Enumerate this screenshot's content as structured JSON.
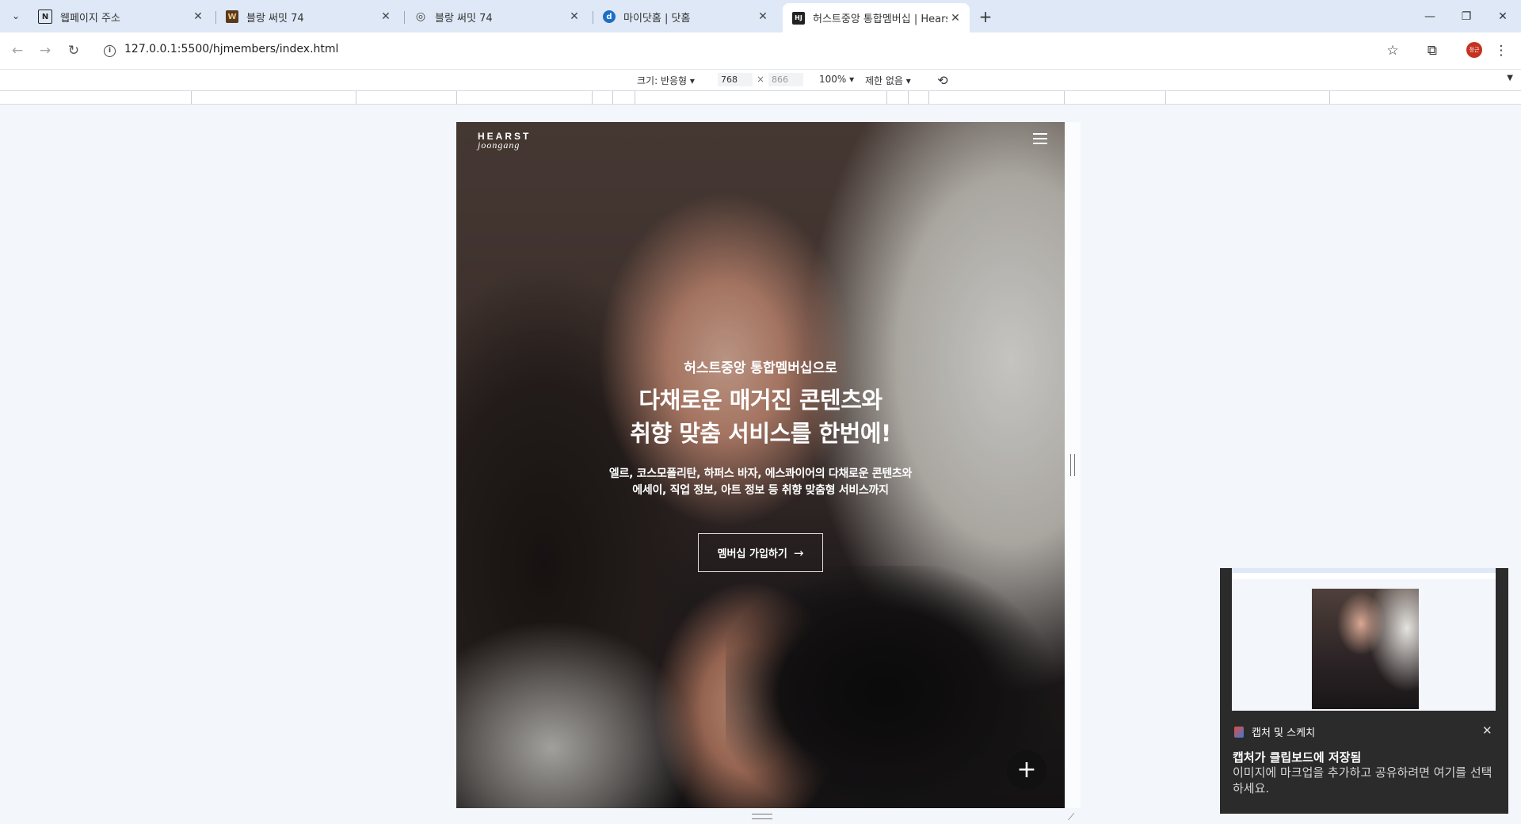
{
  "tabs": [
    {
      "title": "웹페이지 주소",
      "favicon": "notion-icon",
      "fav_text": "N",
      "active": false
    },
    {
      "title": "블랑 써밋 74",
      "favicon": "blanc-icon",
      "fav_text": "W",
      "active": false
    },
    {
      "title": "블랑 써밋 74",
      "favicon": "globe-icon",
      "fav_text": "◎",
      "active": false
    },
    {
      "title": "마이닷홈 | 닷홈",
      "favicon": "dothome-icon",
      "fav_text": "d",
      "active": false
    },
    {
      "title": "허스트중앙 통합멤버십 | Hears",
      "favicon": "hj-icon",
      "fav_text": "HJ",
      "active": true
    }
  ],
  "address_bar": {
    "url": "127.0.0.1:5500/hjmembers/index.html"
  },
  "profile_initials": "정근",
  "device_toolbar": {
    "size_label": "크기: 반응형 ▾",
    "width": "768",
    "times": "×",
    "height": "866",
    "zoom": "100% ▾",
    "throttle": "제한 없음 ▾"
  },
  "site": {
    "logo_line1": "HEARST",
    "logo_line2": "joongang",
    "hero_sub": "허스트중앙 통합멤버십으로",
    "hero_title_1": "다채로운 매거진 콘텐츠와",
    "hero_title_2": "취향 맞춤 서비스를 한번에!",
    "hero_desc_1": "엘르, 코스모폴리탄, 하퍼스 바자, 에스콰이어의 다채로운 콘텐츠와",
    "hero_desc_2": "에세이, 직업 정보, 아트 정보 등 취향 맞춤형 서비스까지",
    "cta_label": "멤버십 가입하기",
    "cta_arrow": "→",
    "fab_label": "+"
  },
  "toast": {
    "app_name": "캡처 및 스케치",
    "title": "캡처가 클립보드에 저장됨",
    "body": "이미지에 마크업을 추가하고 공유하려면 여기를 선택하세요."
  }
}
